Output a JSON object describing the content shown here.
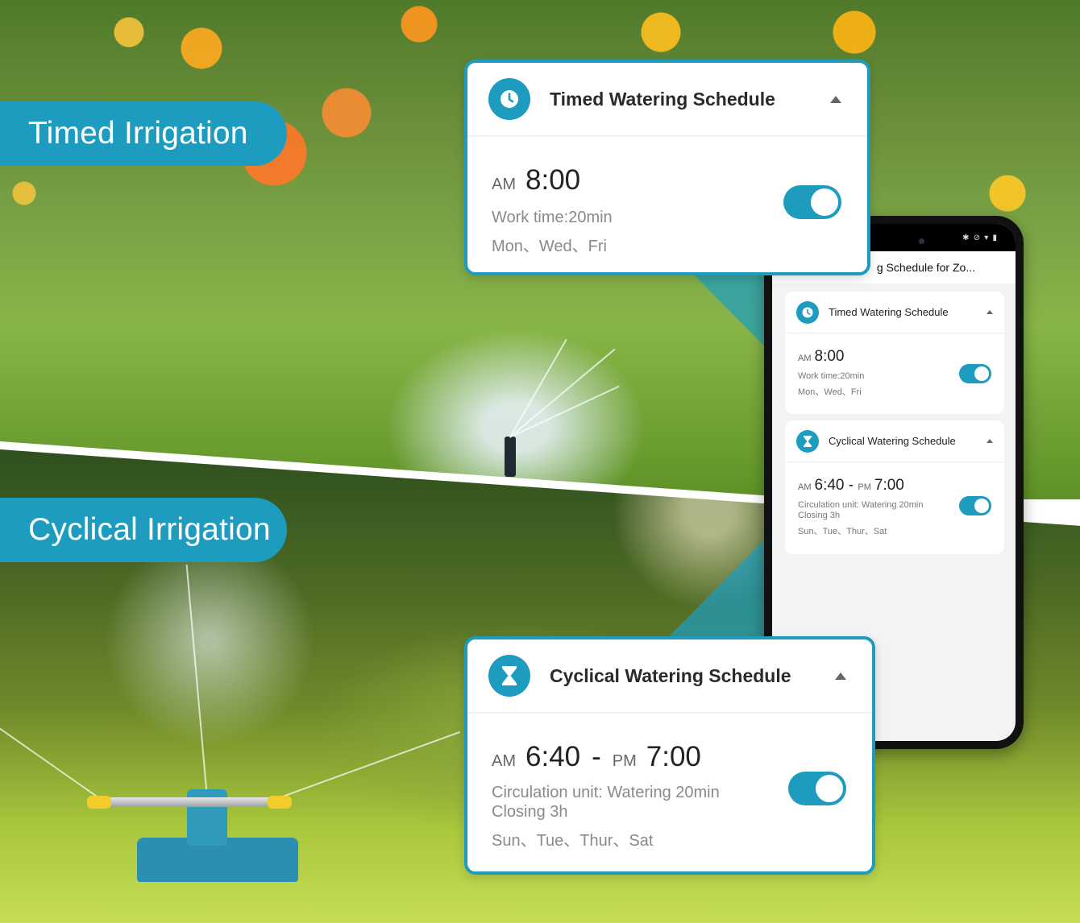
{
  "banners": {
    "timed": "Timed Irrigation",
    "cyclical": "Cyclical Irrigation"
  },
  "timed_card": {
    "icon": "clock-icon",
    "title": "Timed Watering Schedule",
    "ampm": "AM",
    "time": "8:00",
    "work_time": "Work time:20min",
    "days": "Mon、Wed、Fri",
    "enabled": true
  },
  "cyclical_card": {
    "icon": "hourglass-icon",
    "title": "Cyclical Watering Schedule",
    "start_ampm": "AM",
    "start_time": "6:40",
    "separator": "-",
    "end_ampm": "PM",
    "end_time": "7:00",
    "circulation": "Circulation unit: Watering 20min",
    "closing": "Closing 3h",
    "days": "Sun、Tue、Thur、Sat",
    "enabled": true
  },
  "phone": {
    "status_icons": "✱ ⊘ ▾ ▮",
    "header_title": "g Schedule for Zo...",
    "timed": {
      "title": "Timed Watering Schedule",
      "ampm": "AM",
      "time": "8:00",
      "work_time": "Work time:20min",
      "days": "Mon、Wed、Fri",
      "enabled": true
    },
    "cyclical": {
      "title": "Cyclical Watering Schedule",
      "start_ampm": "AM",
      "start_time": "6:40",
      "separator": "-",
      "end_ampm": "PM",
      "end_time": "7:00",
      "circulation": "Circulation unit: Watering 20min",
      "closing": "Closing 3h",
      "days": "Sun、Tue、Thur、Sat",
      "enabled": true
    }
  },
  "colors": {
    "accent": "#1d9cc0",
    "toggle_knob": "#ffffff",
    "card_border": "#1d9cc0"
  }
}
